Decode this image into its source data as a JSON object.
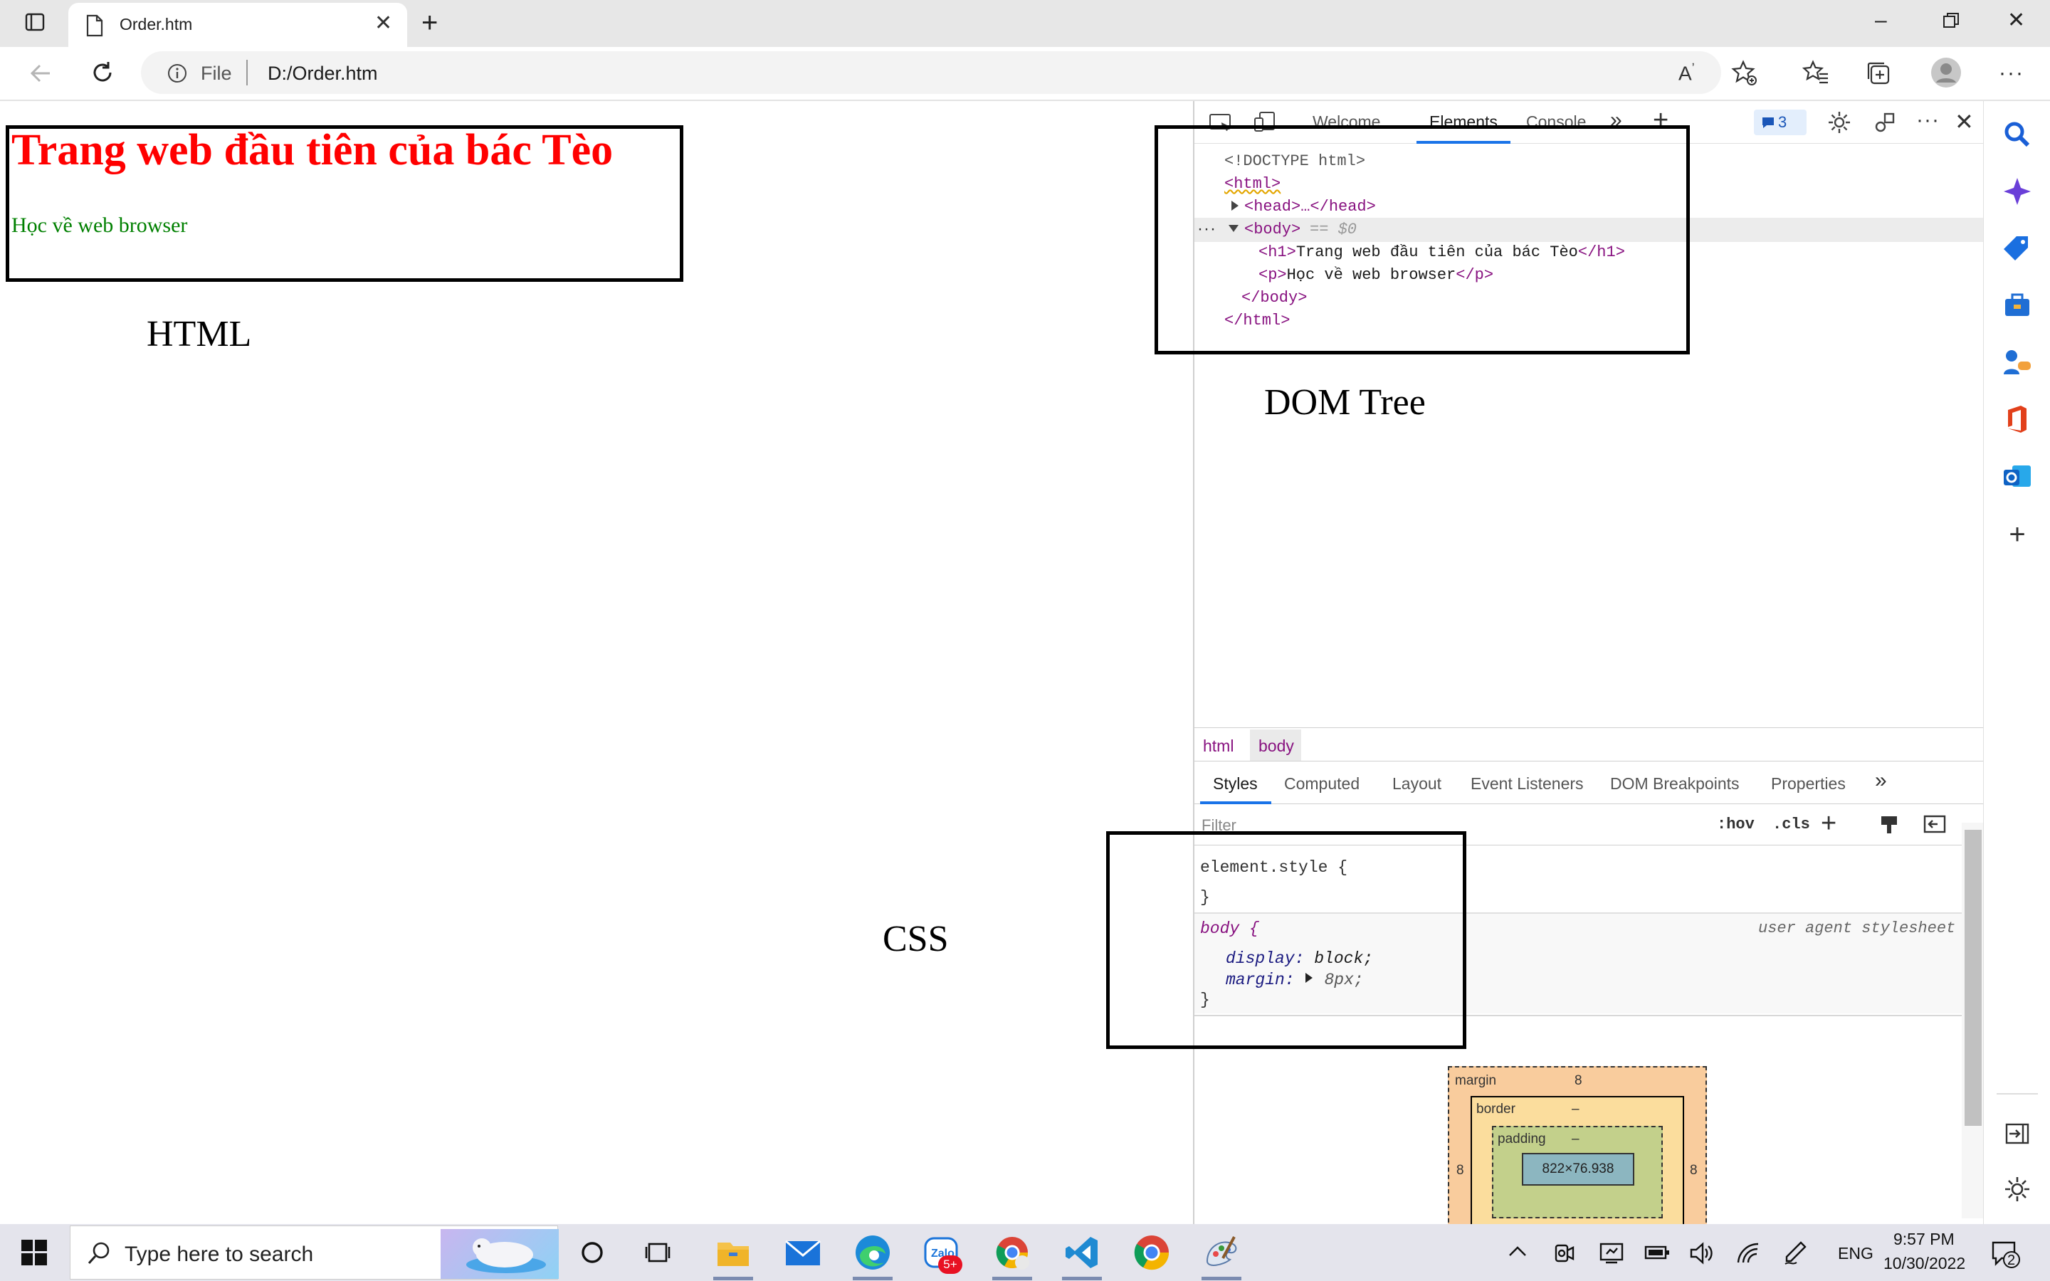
{
  "browser": {
    "tab_title": "Order.htm",
    "address_prefix": "File",
    "url": "D:/Order.htm"
  },
  "page": {
    "h1": "Trang web đầu tiên của bác Tèo",
    "p": "Học về web browser"
  },
  "annotations": {
    "html_label": "HTML",
    "dom_label": "DOM Tree",
    "css_label": "CSS"
  },
  "devtools": {
    "tabs": [
      "Welcome",
      "Elements",
      "Console"
    ],
    "issues_count": "3",
    "dom": {
      "doctype": "<!DOCTYPE html>",
      "html_open": "<html>",
      "head": "<head>…</head>",
      "body_open": "<body>",
      "body_marker": "== $0",
      "h1_line": "Trang web đầu tiên của bác Tèo",
      "p_line": "Học về web browser",
      "body_close": "</body>",
      "html_close": "</html>"
    },
    "breadcrumbs": [
      "html",
      "body"
    ],
    "subtabs": [
      "Styles",
      "Computed",
      "Layout",
      "Event Listeners",
      "DOM Breakpoints",
      "Properties"
    ],
    "filter_placeholder": "Filter",
    "hov": ":hov",
    "cls": ".cls",
    "styles": {
      "element_style": "element.style {",
      "close_brace": "}",
      "body_selector": "body {",
      "ua_label": "user agent stylesheet",
      "display_name": "display",
      "display_value": "block;",
      "margin_name": "margin",
      "margin_value": "8px;"
    },
    "box_model": {
      "margin_label": "margin",
      "margin_top": "8",
      "margin_left": "8",
      "margin_right": "8",
      "border_label": "border",
      "border_value": "–",
      "padding_label": "padding",
      "padding_value": "–",
      "content": "822×76.938"
    }
  },
  "taskbar": {
    "search_placeholder": "Type here to search",
    "zalo_badge": "5+",
    "lang": "ENG",
    "time": "9:57 PM",
    "date": "10/30/2022",
    "notifications": "2"
  }
}
